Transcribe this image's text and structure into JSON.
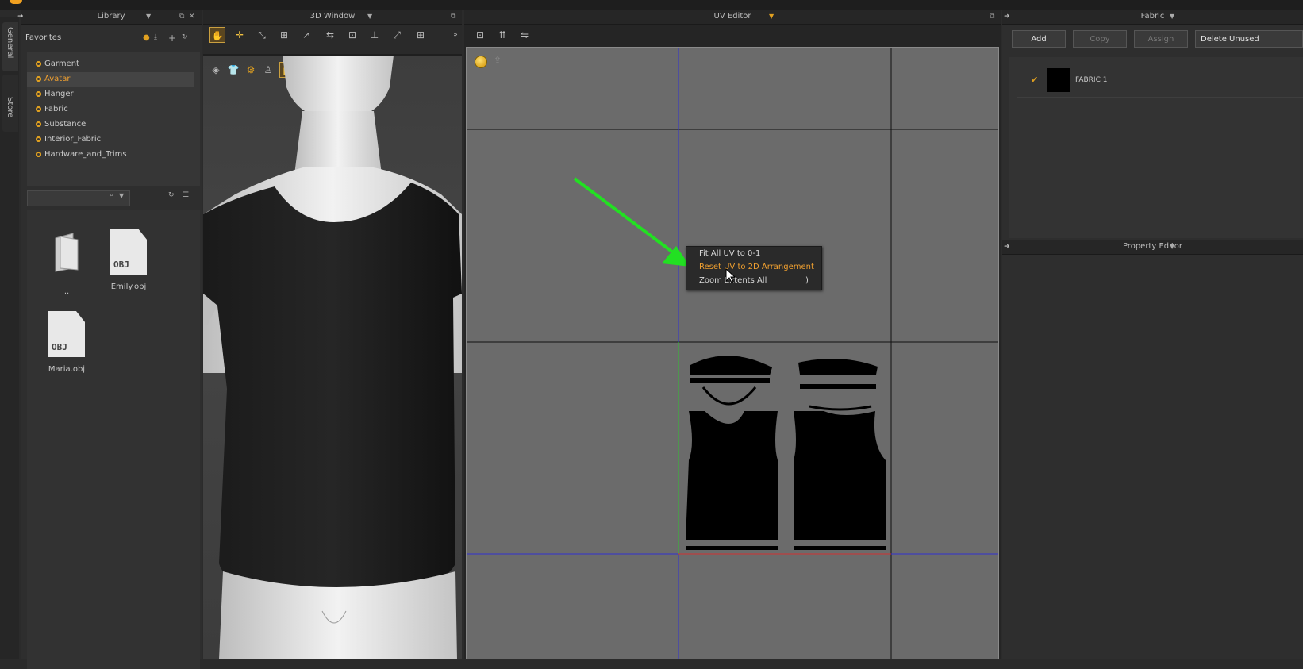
{
  "vertical_tabs": [
    "General",
    "Store"
  ],
  "library": {
    "title": "Library",
    "favorites_label": "Favorites",
    "favorites": [
      "Garment",
      "Avatar",
      "Hanger",
      "Fabric",
      "Substance",
      "Interior_Fabric",
      "Hardware_and_Trims"
    ],
    "active_favorite": "Avatar",
    "search_placeholder": "",
    "files": [
      {
        "name": "..",
        "type": "folder"
      },
      {
        "name": "Emily.obj",
        "type": "obj",
        "badge": "OBJ"
      },
      {
        "name": "Maria.obj",
        "type": "obj",
        "badge": "OBJ"
      }
    ]
  },
  "window3d": {
    "title": "3D Window"
  },
  "uv_editor": {
    "title": "UV Editor",
    "context_menu": [
      {
        "label": "Fit All UV to 0-1",
        "highlighted": false
      },
      {
        "label": "Reset UV to 2D Arrangement",
        "highlighted": true
      },
      {
        "label": "Zoom Extents All",
        "shortcut": ")",
        "highlighted": false
      }
    ]
  },
  "fabric_panel": {
    "title": "Fabric",
    "buttons": [
      {
        "label": "Add",
        "enabled": true
      },
      {
        "label": "Copy",
        "enabled": false
      },
      {
        "label": "Assign",
        "enabled": false
      },
      {
        "label": "Delete Unused",
        "enabled": true
      }
    ],
    "fabrics": [
      {
        "name": "FABRIC 1",
        "color": "#000000",
        "checked": true
      }
    ],
    "property_editor_title": "Property Editor"
  },
  "colors": {
    "accent": "#f0a030",
    "arrow": "#22e022",
    "grid_line": "#111111",
    "axis_blue": "#3030d0",
    "axis_green": "#30c030",
    "axis_red": "#d03030"
  }
}
